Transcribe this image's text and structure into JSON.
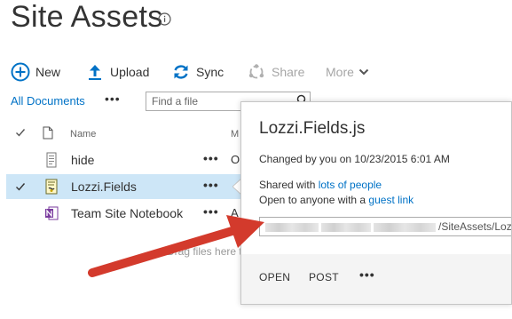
{
  "page": {
    "title": "Site Assets"
  },
  "commands": {
    "new_label": "New",
    "upload_label": "Upload",
    "sync_label": "Sync",
    "share_label": "Share",
    "more_label": "More"
  },
  "view": {
    "current_view": "All Documents",
    "ellipsis": "•••",
    "search_placeholder": "Find a file"
  },
  "list": {
    "columns": {
      "name": "Name",
      "modified_initial": "M"
    },
    "rows": [
      {
        "name": "hide",
        "menu": "•••",
        "modified_fragment": "O",
        "selected": false,
        "icon": "text-file-icon"
      },
      {
        "name": "Lozzi.Fields",
        "menu": "•••",
        "modified_fragment": "",
        "selected": true,
        "icon": "js-file-icon"
      },
      {
        "name": "Team Site Notebook",
        "menu": "•••",
        "modified_fragment": "A",
        "selected": false,
        "icon": "onenote-icon"
      }
    ],
    "drag_hint": "Drag files here t"
  },
  "callout": {
    "title": "Lozzi.Fields.js",
    "changed": "Changed by you on 10/23/2015 6:01 AM",
    "shared_prefix": "Shared with ",
    "shared_link": "lots of people",
    "open_prefix": "Open to anyone with a ",
    "open_link": "guest link",
    "url_visible": "/SiteAssets/Loz",
    "open_button": "OPEN",
    "post_button": "POST",
    "more_dots": "•••"
  },
  "colors": {
    "accent": "#0072c6",
    "selection": "#cde6f7",
    "annotation_arrow": "#e5473a"
  }
}
